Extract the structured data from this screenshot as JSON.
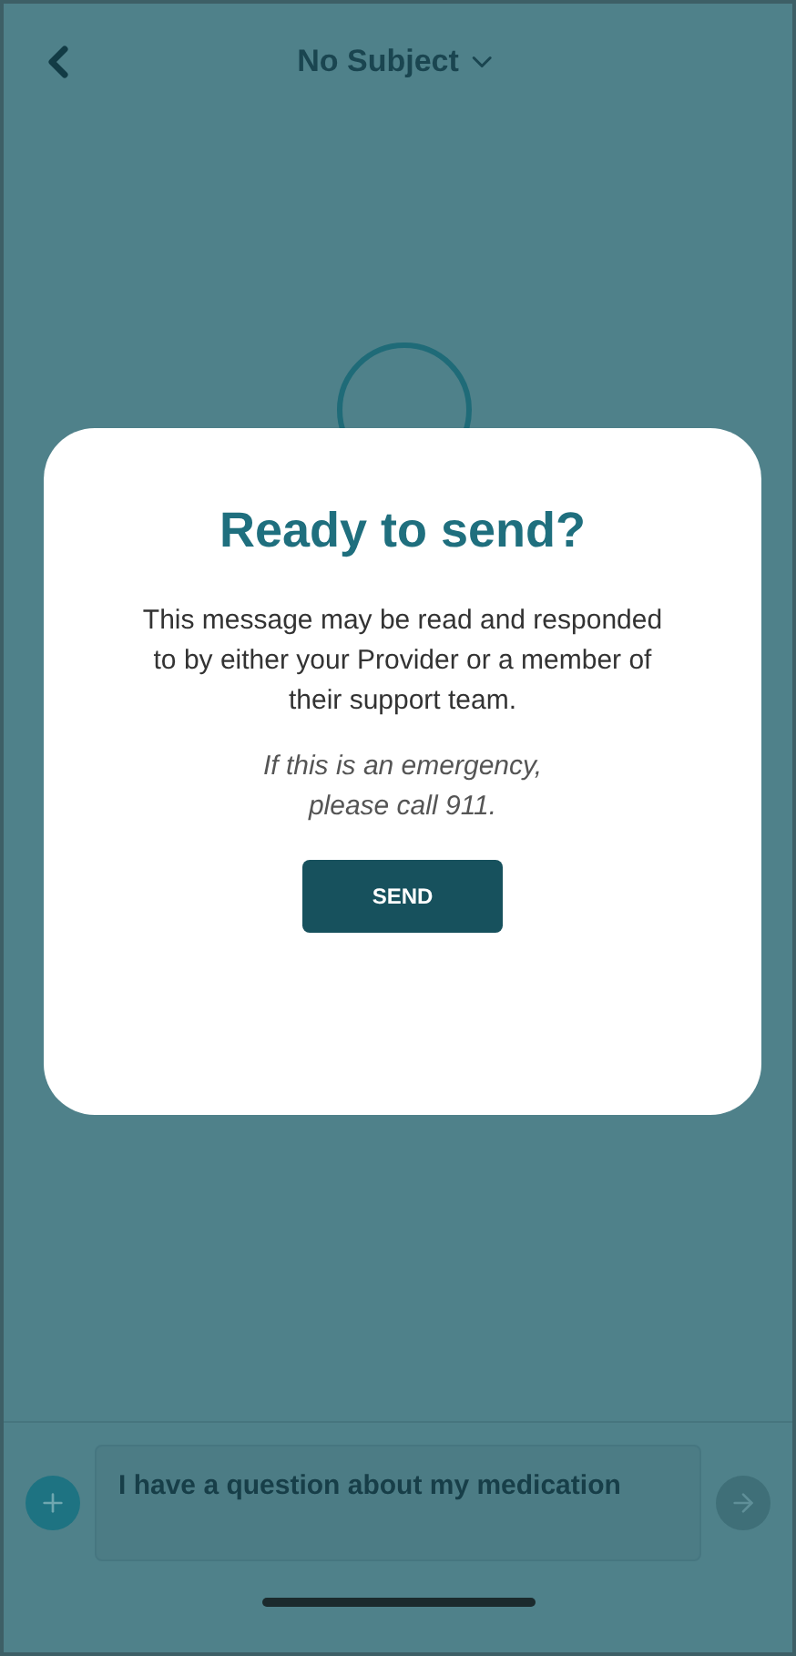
{
  "header": {
    "title": "No Subject"
  },
  "composer": {
    "value": "I have a question about my medication"
  },
  "dialog": {
    "title": "Ready to send?",
    "body": "This message may be read and responded to by either your Provider or a member of their support team.",
    "note": "If this is an emergency, please call 911.",
    "button": "SEND"
  }
}
